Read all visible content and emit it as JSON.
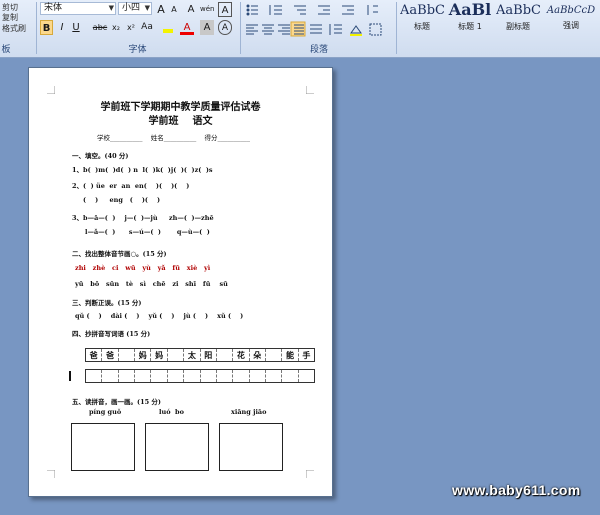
{
  "ribbon": {
    "clipboard": {
      "cut": "剪切",
      "copy": "复制",
      "format_painter": "格式刷",
      "group": "板"
    },
    "font": {
      "name": "宋体",
      "size": "小四",
      "group": "字体",
      "bold": "B",
      "italic": "I",
      "underline": "U",
      "strike": "abc",
      "sub": "x₂",
      "sup": "x²",
      "case": "Aa",
      "color": "A",
      "grow": "A",
      "shrink": "A",
      "clear": "A",
      "phonetic": "wén",
      "border": "A"
    },
    "paragraph": {
      "group": "段落"
    },
    "styles": [
      {
        "sample": "AaBbC",
        "name": "标题"
      },
      {
        "sample": "AaBl",
        "name": "标题 1"
      },
      {
        "sample": "AaBbC",
        "name": "副标题"
      },
      {
        "sample": "AaBbCcD",
        "name": "强调"
      }
    ]
  },
  "doc": {
    "title1": "学前班下学期期中教学质量评估试卷",
    "title2": "学前班    语文",
    "info": "学校__________    姓名__________    得分__________",
    "s1": "一、填空。(40 分)",
    "s1_l1": "1、b(  )m(  )d(  ) n  l(  )k(  )j(  )(  )z(  )s",
    "s1_l2": "2、(  ) üe  er  an  en(    )(    )(    )",
    "s1_l3": "(    )     eng   (    )(    )",
    "s1_l4": "3、b—ā—(  )    j—(  )—jù     zh—(  )—zhē",
    "s1_l5": "l—ǎ—(  )      s—ú—(  )       q—ù—(  )",
    "s2": "二、找出整体音节画○。(15 分)",
    "s2_l1": "zhi   zhè   ci   wū   yù   yǎ   fū   xiè   yì",
    "s2_l2": "yū   bō   sūn   tè   sì   chē   zi   shī   fū    sū",
    "s3": "三、判断正误。(15 分)",
    "s3_l1": "qǔ (    )    dài (    )    yǔ (    )    jù (    )    xǔ (    )",
    "s4": "四、抄拼音写词语 (15 分)",
    "grid_words": [
      "爸",
      "爸",
      "",
      "妈",
      "妈",
      "",
      "太",
      "阳",
      "",
      "花",
      "朵",
      "",
      "能",
      "手"
    ],
    "s5": "五、读拼音，画一画。(15 分)",
    "pics": [
      "píng guǒ",
      "luó  bo",
      "xiāng jiāo"
    ]
  },
  "watermark": "www.baby611.com"
}
